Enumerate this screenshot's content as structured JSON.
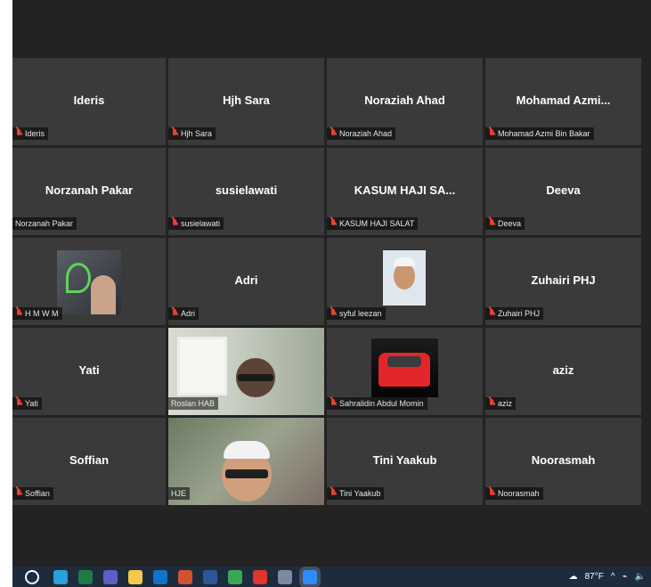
{
  "participants": [
    {
      "name_big": "Ideris",
      "label": "Ideris",
      "muted": true
    },
    {
      "name_big": "Hjh Sara",
      "label": "Hjh Sara",
      "muted": true
    },
    {
      "name_big": "Noraziah Ahad",
      "label": "Noraziah Ahad",
      "muted": true
    },
    {
      "name_big": "Mohamad  Azmi...",
      "label": "Mohamad Azmi Bin Bakar",
      "muted": true
    },
    {
      "name_big": "Norzanah Pakar",
      "label": "Norzanah Pakar",
      "muted": false
    },
    {
      "name_big": "susielawati",
      "label": "susielawati",
      "muted": true
    },
    {
      "name_big": "KASUM HAJI SA...",
      "label": "KASUM HAJI SALAT",
      "muted": true
    },
    {
      "name_big": "Deeva",
      "label": "Deeva",
      "muted": true
    },
    {
      "name_big": "",
      "label": "H M W M",
      "muted": true,
      "media": "hmwm"
    },
    {
      "name_big": "Adri",
      "label": "Adri",
      "muted": true
    },
    {
      "name_big": "",
      "label": "syful leezan",
      "muted": true,
      "media": "syful"
    },
    {
      "name_big": "Zuhairi PHJ",
      "label": "Zuhairi PHJ",
      "muted": true
    },
    {
      "name_big": "Yati",
      "label": "Yati",
      "muted": true
    },
    {
      "name_big": "",
      "label": "Roslan HAB",
      "muted": false,
      "media": "roslan"
    },
    {
      "name_big": "",
      "label": "Sahralidin Abdul Momin",
      "muted": true,
      "media": "car"
    },
    {
      "name_big": "aziz",
      "label": "aziz",
      "muted": true
    },
    {
      "name_big": "Soffian",
      "label": "Soffian",
      "muted": true
    },
    {
      "name_big": "",
      "label": "HJE",
      "muted": false,
      "media": "hje",
      "active_speaker": true
    },
    {
      "name_big": "Tini Yaakub",
      "label": "Tini Yaakub",
      "muted": true
    },
    {
      "name_big": "Noorasmah",
      "label": "Noorasmah",
      "muted": true
    }
  ],
  "taskbar": {
    "apps": [
      {
        "icon": "edge-icon",
        "color": "#2a9fd8"
      },
      {
        "icon": "excel-icon",
        "color": "#1f7a45"
      },
      {
        "icon": "teams-icon",
        "color": "#5b5fc7"
      },
      {
        "icon": "file-explorer-icon",
        "color": "#f2c94c"
      },
      {
        "icon": "outlook-icon",
        "color": "#1173c8"
      },
      {
        "icon": "powerpoint-icon",
        "color": "#d35230"
      },
      {
        "icon": "word-icon",
        "color": "#2b5797"
      },
      {
        "icon": "chrome-icon",
        "color": "#3aa757"
      },
      {
        "icon": "opera-icon",
        "color": "#e0342c"
      },
      {
        "icon": "photos-icon",
        "color": "#7a8aa0"
      },
      {
        "icon": "zoom-icon",
        "color": "#2d8cff",
        "active": true
      }
    ],
    "weather": "87°F",
    "colors": {
      "background": "#1d2c3c",
      "meeting_bg": "#232323",
      "tile_bg": "#3a3a3a",
      "highlight": "#b8d86a",
      "mic_muted": "#e8412f"
    }
  }
}
